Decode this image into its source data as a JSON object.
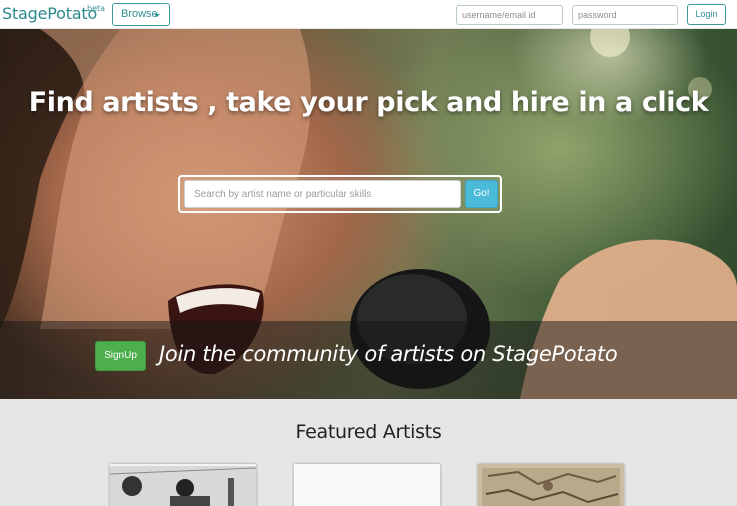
{
  "navbar": {
    "brand": "StagePotato",
    "brand_badge": "beta",
    "browse_label": "Browse",
    "username_placeholder": "username/email id",
    "password_placeholder": "password",
    "login_label": "Login"
  },
  "hero": {
    "headline": "Find artists , take your pick and hire in a click",
    "search_placeholder": "Search by artist name or particular skills",
    "search_button": "Go!",
    "signup_label": "SignUp",
    "join_text": "Join the community of artists on StagePotato"
  },
  "featured": {
    "title": "Featured Artists",
    "cards": [
      {
        "kind": "photo-monochrome"
      },
      {
        "kind": "blank"
      },
      {
        "kind": "photo-sepia"
      }
    ]
  },
  "colors": {
    "brand": "#2a8a8c",
    "go_button": "#4bbad9",
    "signup_button": "#4cae4c",
    "featured_bg": "#e6e6e6"
  }
}
